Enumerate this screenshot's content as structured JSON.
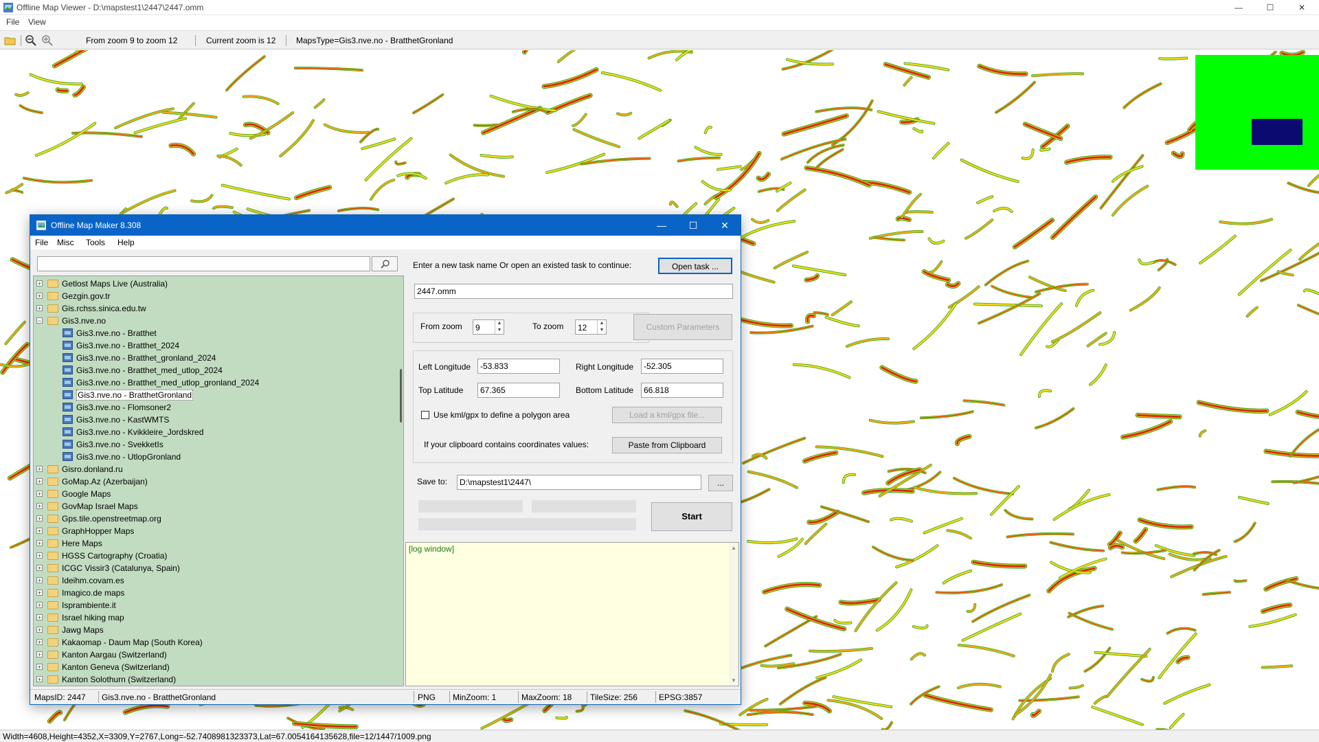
{
  "viewer": {
    "title": "Offline Map Viewer - D:\\mapstest1\\2447\\2447.omm",
    "menu": [
      "File",
      "View"
    ],
    "toolbar": {
      "zoom_range": "From zoom 9 to zoom 12",
      "current_zoom": "Current zoom is 12",
      "maps_type": "MapsType=Gis3.nve.no - BratthetGronland"
    },
    "status": "Width=4608,Height=4352,X=3309,Y=2767,Long=-52.7408981323373,Lat=67.0054164135628,file=12/1447/1009.png",
    "controls": {
      "minimize": "—",
      "maximize": "☐",
      "close": "✕"
    }
  },
  "dialog": {
    "title": "Offline Map Maker 8.308",
    "menu": [
      "File",
      "Misc",
      "Tools",
      "Help"
    ],
    "controls": {
      "minimize": "—",
      "maximize": "☐",
      "close": "✕"
    },
    "search": {
      "placeholder": "",
      "value": ""
    },
    "tree": [
      {
        "label": "Getlost Maps Live (Australia)",
        "type": "folder",
        "expanded": false
      },
      {
        "label": "Gezgin.gov.tr",
        "type": "folder",
        "expanded": false
      },
      {
        "label": "Gis.rchss.sinica.edu.tw",
        "type": "folder",
        "expanded": false
      },
      {
        "label": "Gis3.nve.no",
        "type": "folder",
        "expanded": true
      },
      {
        "label": "Gis3.nve.no - Bratthet",
        "type": "map"
      },
      {
        "label": "Gis3.nve.no - Bratthet_2024",
        "type": "map"
      },
      {
        "label": "Gis3.nve.no - Bratthet_gronland_2024",
        "type": "map"
      },
      {
        "label": "Gis3.nve.no - Bratthet_med_utlop_2024",
        "type": "map"
      },
      {
        "label": "Gis3.nve.no - Bratthet_med_utlop_gronland_2024",
        "type": "map"
      },
      {
        "label": "Gis3.nve.no - BratthetGronland",
        "type": "map",
        "selected": true
      },
      {
        "label": "Gis3.nve.no - Flomsoner2",
        "type": "map"
      },
      {
        "label": "Gis3.nve.no - KastWMTS",
        "type": "map"
      },
      {
        "label": "Gis3.nve.no - Kvikkleire_Jordskred",
        "type": "map"
      },
      {
        "label": "Gis3.nve.no - SvekketIs",
        "type": "map"
      },
      {
        "label": "Gis3.nve.no - UtlopGronland",
        "type": "map"
      },
      {
        "label": "Gisro.donland.ru",
        "type": "folder",
        "expanded": false
      },
      {
        "label": "GoMap.Az (Azerbaijan)",
        "type": "folder",
        "expanded": false
      },
      {
        "label": "Google Maps",
        "type": "folder",
        "expanded": false
      },
      {
        "label": "GovMap Israel Maps",
        "type": "folder",
        "expanded": false
      },
      {
        "label": "Gps.tile.openstreetmap.org",
        "type": "folder",
        "expanded": false
      },
      {
        "label": "GraphHopper Maps",
        "type": "folder",
        "expanded": false
      },
      {
        "label": "Here Maps",
        "type": "folder",
        "expanded": false
      },
      {
        "label": "HGSS Cartography (Croatia)",
        "type": "folder",
        "expanded": false
      },
      {
        "label": "ICGC Vissir3 (Catalunya, Spain)",
        "type": "folder",
        "expanded": false
      },
      {
        "label": "Ideihm.covam.es",
        "type": "folder",
        "expanded": false
      },
      {
        "label": "Imagico.de maps",
        "type": "folder",
        "expanded": false
      },
      {
        "label": "Isprambiente.it",
        "type": "folder",
        "expanded": false
      },
      {
        "label": "Israel hiking map",
        "type": "folder",
        "expanded": false
      },
      {
        "label": "Jawg Maps",
        "type": "folder",
        "expanded": false
      },
      {
        "label": "Kakaomap - Daum Map (South Korea)",
        "type": "folder",
        "expanded": false
      },
      {
        "label": "Kanton Aargau (Switzerland)",
        "type": "folder",
        "expanded": false
      },
      {
        "label": "Kanton Geneva (Switzerland)",
        "type": "folder",
        "expanded": false
      },
      {
        "label": "Kanton Solothurn (Switzerland)",
        "type": "folder",
        "expanded": false
      }
    ],
    "task": {
      "prompt": "Enter a new task name Or open an existed task to continue:",
      "open_button": "Open task ...",
      "name": "2447.omm"
    },
    "zoom": {
      "from_label": "From zoom",
      "from_value": "9",
      "to_label": "To zoom",
      "to_value": "12",
      "custom_button": "Custom Parameters"
    },
    "coords": {
      "left_lon_label": "Left Longitude",
      "left_lon": "-53.833",
      "right_lon_label": "Right Longitude",
      "right_lon": "-52.305",
      "top_lat_label": "Top Latitude",
      "top_lat": "67.365",
      "bottom_lat_label": "Bottom Latitude",
      "bottom_lat": "66.818",
      "kml_label": "Use kml/gpx to define a polygon area",
      "kml_checked": false,
      "kml_button": "Load a kml/gpx file...",
      "clipboard_label": "If your clipboard contains coordinates values:",
      "clipboard_button": "Paste from Clipboard"
    },
    "save": {
      "label": "Save to:",
      "path": "D:\\mapstest1\\2447\\",
      "browse": "..."
    },
    "start_button": "Start",
    "log": "[log window]",
    "status": {
      "maps_id": "MapsID: 2447",
      "maps_name": "Gis3.nve.no - BratthetGronland",
      "format": "PNG",
      "min_zoom": "MinZoom: 1",
      "max_zoom": "MaxZoom: 18",
      "tile_size": "TileSize: 256",
      "epsg": "EPSG:3857"
    }
  },
  "colors": {
    "overview_bg": "#00ff00",
    "overview_rect": "#0a0a70",
    "tree_bg": "#c2dcc2",
    "log_bg": "#ffffe1",
    "dialog_title": "#0a64c8",
    "map_red": "#d62a10",
    "map_orange": "#f08a1a",
    "map_yellow": "#f2dc14",
    "map_green": "#2e9a1e"
  }
}
